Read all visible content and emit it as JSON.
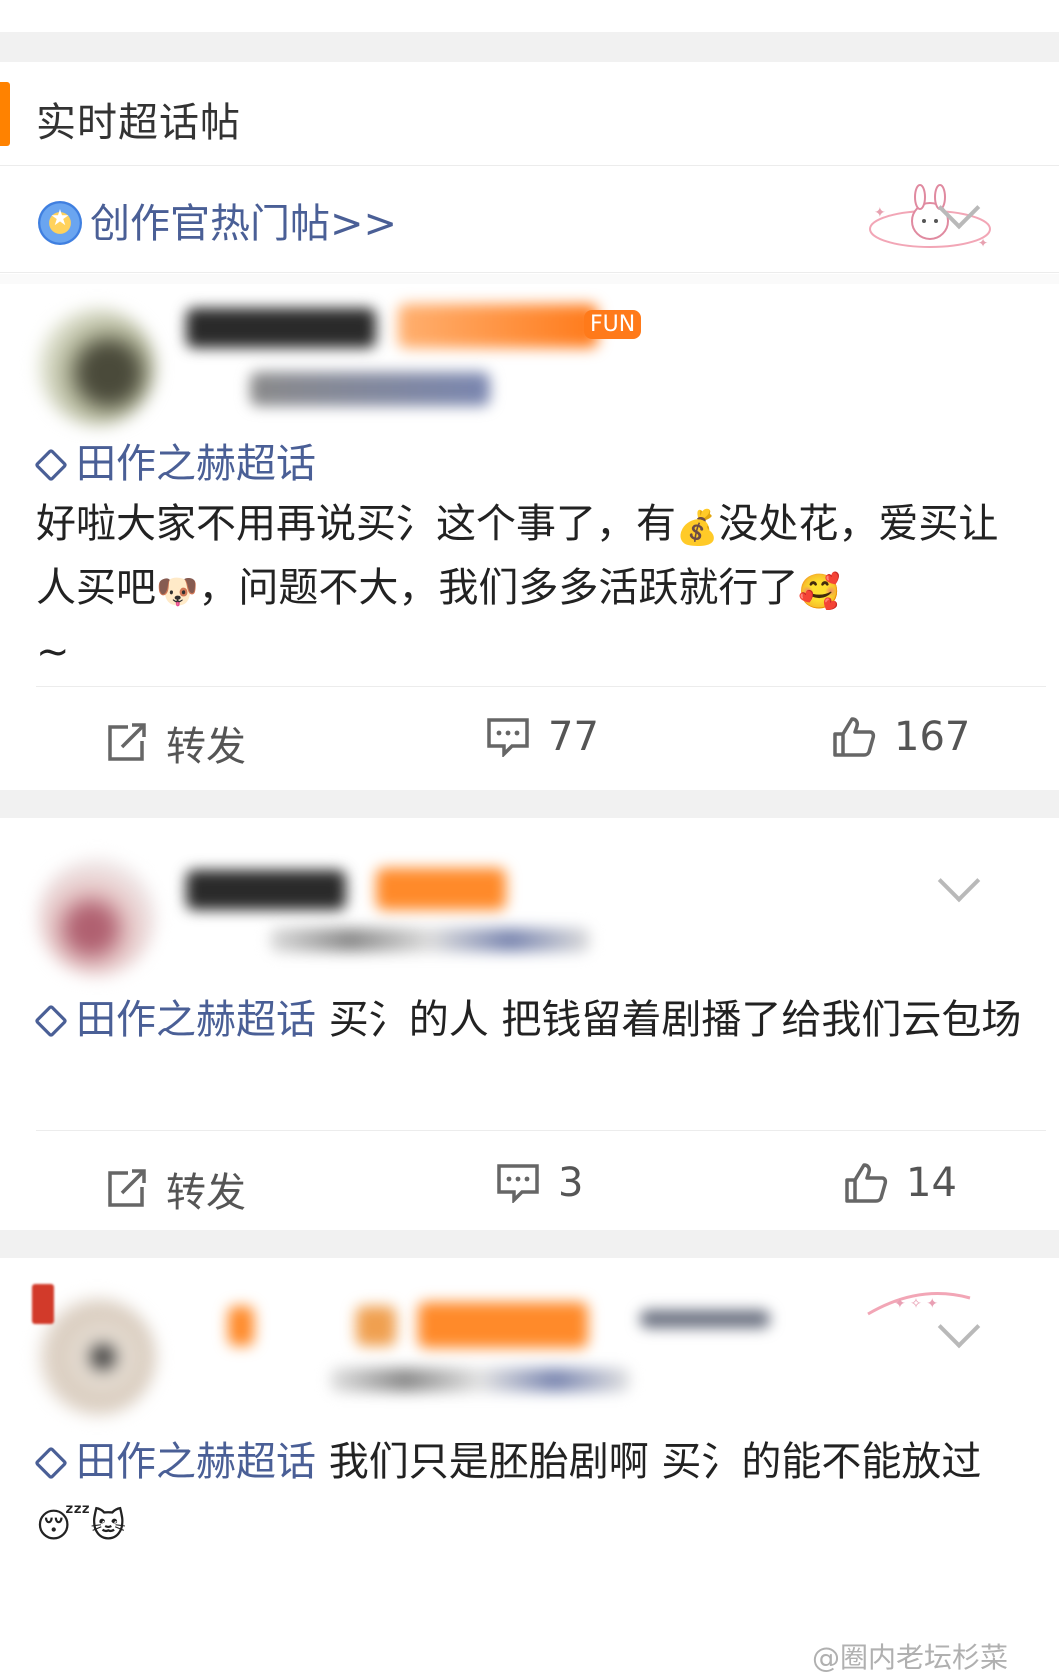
{
  "section": {
    "title": "实时超话帖",
    "creator_link": "创作官热门帖>>"
  },
  "colors": {
    "accent": "#ff8200",
    "link": "#4a5f96",
    "gap": "#f1f1f1"
  },
  "posts": [
    {
      "topic": "田作之赫超话",
      "badge": "FUN",
      "text_a": "好啦大家不用再说买氵这个事了，有",
      "emoji_a": "💰",
      "text_b": "没处花，爱买让人买吧",
      "emoji_b": "🐶",
      "text_c": "，问题不大，我们多多活跃就行了",
      "emoji_c": "🥰",
      "text_d": "~",
      "repost_label": "转发",
      "comments": "77",
      "likes": "167"
    },
    {
      "topic": "田作之赫超话",
      "text_a": " 买氵的人 把钱留着剧播了给我们云包场",
      "repost_label": "转发",
      "comments": "3",
      "likes": "14"
    },
    {
      "topic": "田作之赫超话",
      "text_a": "  我们只是胚胎剧啊 买氵的能不能放过",
      "emoji_a": "😴",
      "emoji_b": "🐱"
    }
  ],
  "watermark": "@圈内老坛杉菜",
  "icons": [
    "medal-icon",
    "diamond-icon",
    "repost-icon",
    "comment-icon",
    "like-icon",
    "chevron-down-icon"
  ]
}
